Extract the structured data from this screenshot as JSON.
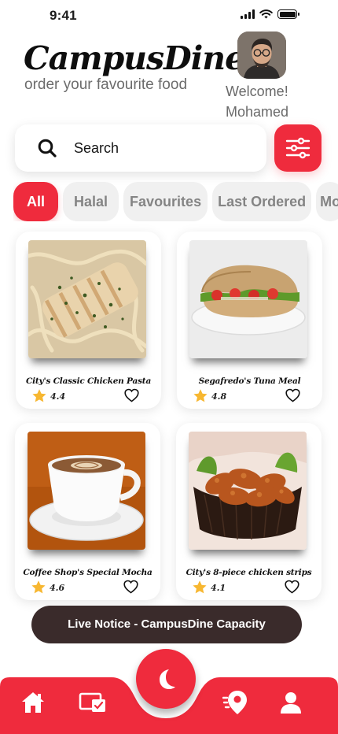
{
  "status_bar": {
    "time": "9:41"
  },
  "header": {
    "brand": "CampusDine",
    "tagline": "order your favourite food",
    "welcome_line1": "Welcome!",
    "welcome_line2": "Mohamed"
  },
  "search": {
    "placeholder": "Search",
    "value": ""
  },
  "categories": [
    {
      "label": "All",
      "active": true
    },
    {
      "label": "Halal",
      "active": false
    },
    {
      "label": "Favourites",
      "active": false
    },
    {
      "label": "Last Ordered",
      "active": false
    },
    {
      "label": "Mo",
      "active": false
    }
  ],
  "foods": [
    {
      "name": "City's Classic Chicken Pasta",
      "rating": "4.4",
      "favourited": false
    },
    {
      "name": "Segafredo's Tuna Meal",
      "rating": "4.8",
      "favourited": false
    },
    {
      "name": "Coffee Shop's Special Mocha",
      "rating": "4.6",
      "favourited": false
    },
    {
      "name": "City's 8-piece chicken strips",
      "rating": "4.1",
      "favourited": false
    }
  ],
  "notice": {
    "label": "Live Notice - CampusDine Capacity"
  },
  "nav": {
    "items": [
      {
        "icon": "home-icon"
      },
      {
        "icon": "wallet-icon"
      },
      {
        "icon": "moon-icon",
        "center": true
      },
      {
        "icon": "location-pin-icon"
      },
      {
        "icon": "user-icon"
      }
    ]
  },
  "colors": {
    "accent": "#ef2b3d",
    "notice_bg": "#3a2b2b",
    "chip_bg": "#f0f0f0",
    "star": "#f7b731"
  }
}
